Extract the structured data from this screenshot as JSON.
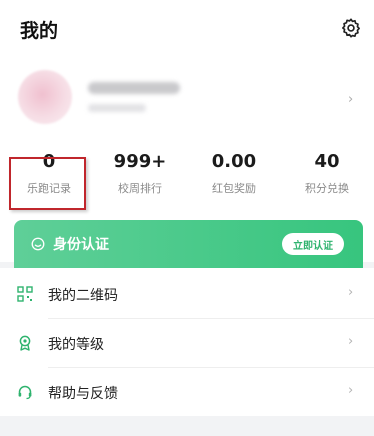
{
  "header": {
    "title": "我的"
  },
  "profile": {
    "chevron": "›"
  },
  "stats": [
    {
      "value": "0",
      "label": "乐跑记录"
    },
    {
      "value": "999+",
      "label": "校周排行"
    },
    {
      "value": "0.00",
      "label": "红包奖励"
    },
    {
      "value": "40",
      "label": "积分兑换"
    }
  ],
  "identity": {
    "title": "身份认证",
    "button": "立即认证"
  },
  "menu": [
    {
      "label": "我的二维码",
      "icon": "qr-code-icon"
    },
    {
      "label": "我的等级",
      "icon": "medal-icon"
    },
    {
      "label": "帮助与反馈",
      "icon": "headset-icon"
    }
  ],
  "chevron": "›",
  "colors": {
    "accent": "#37c57e",
    "highlight": "#c0262c"
  }
}
